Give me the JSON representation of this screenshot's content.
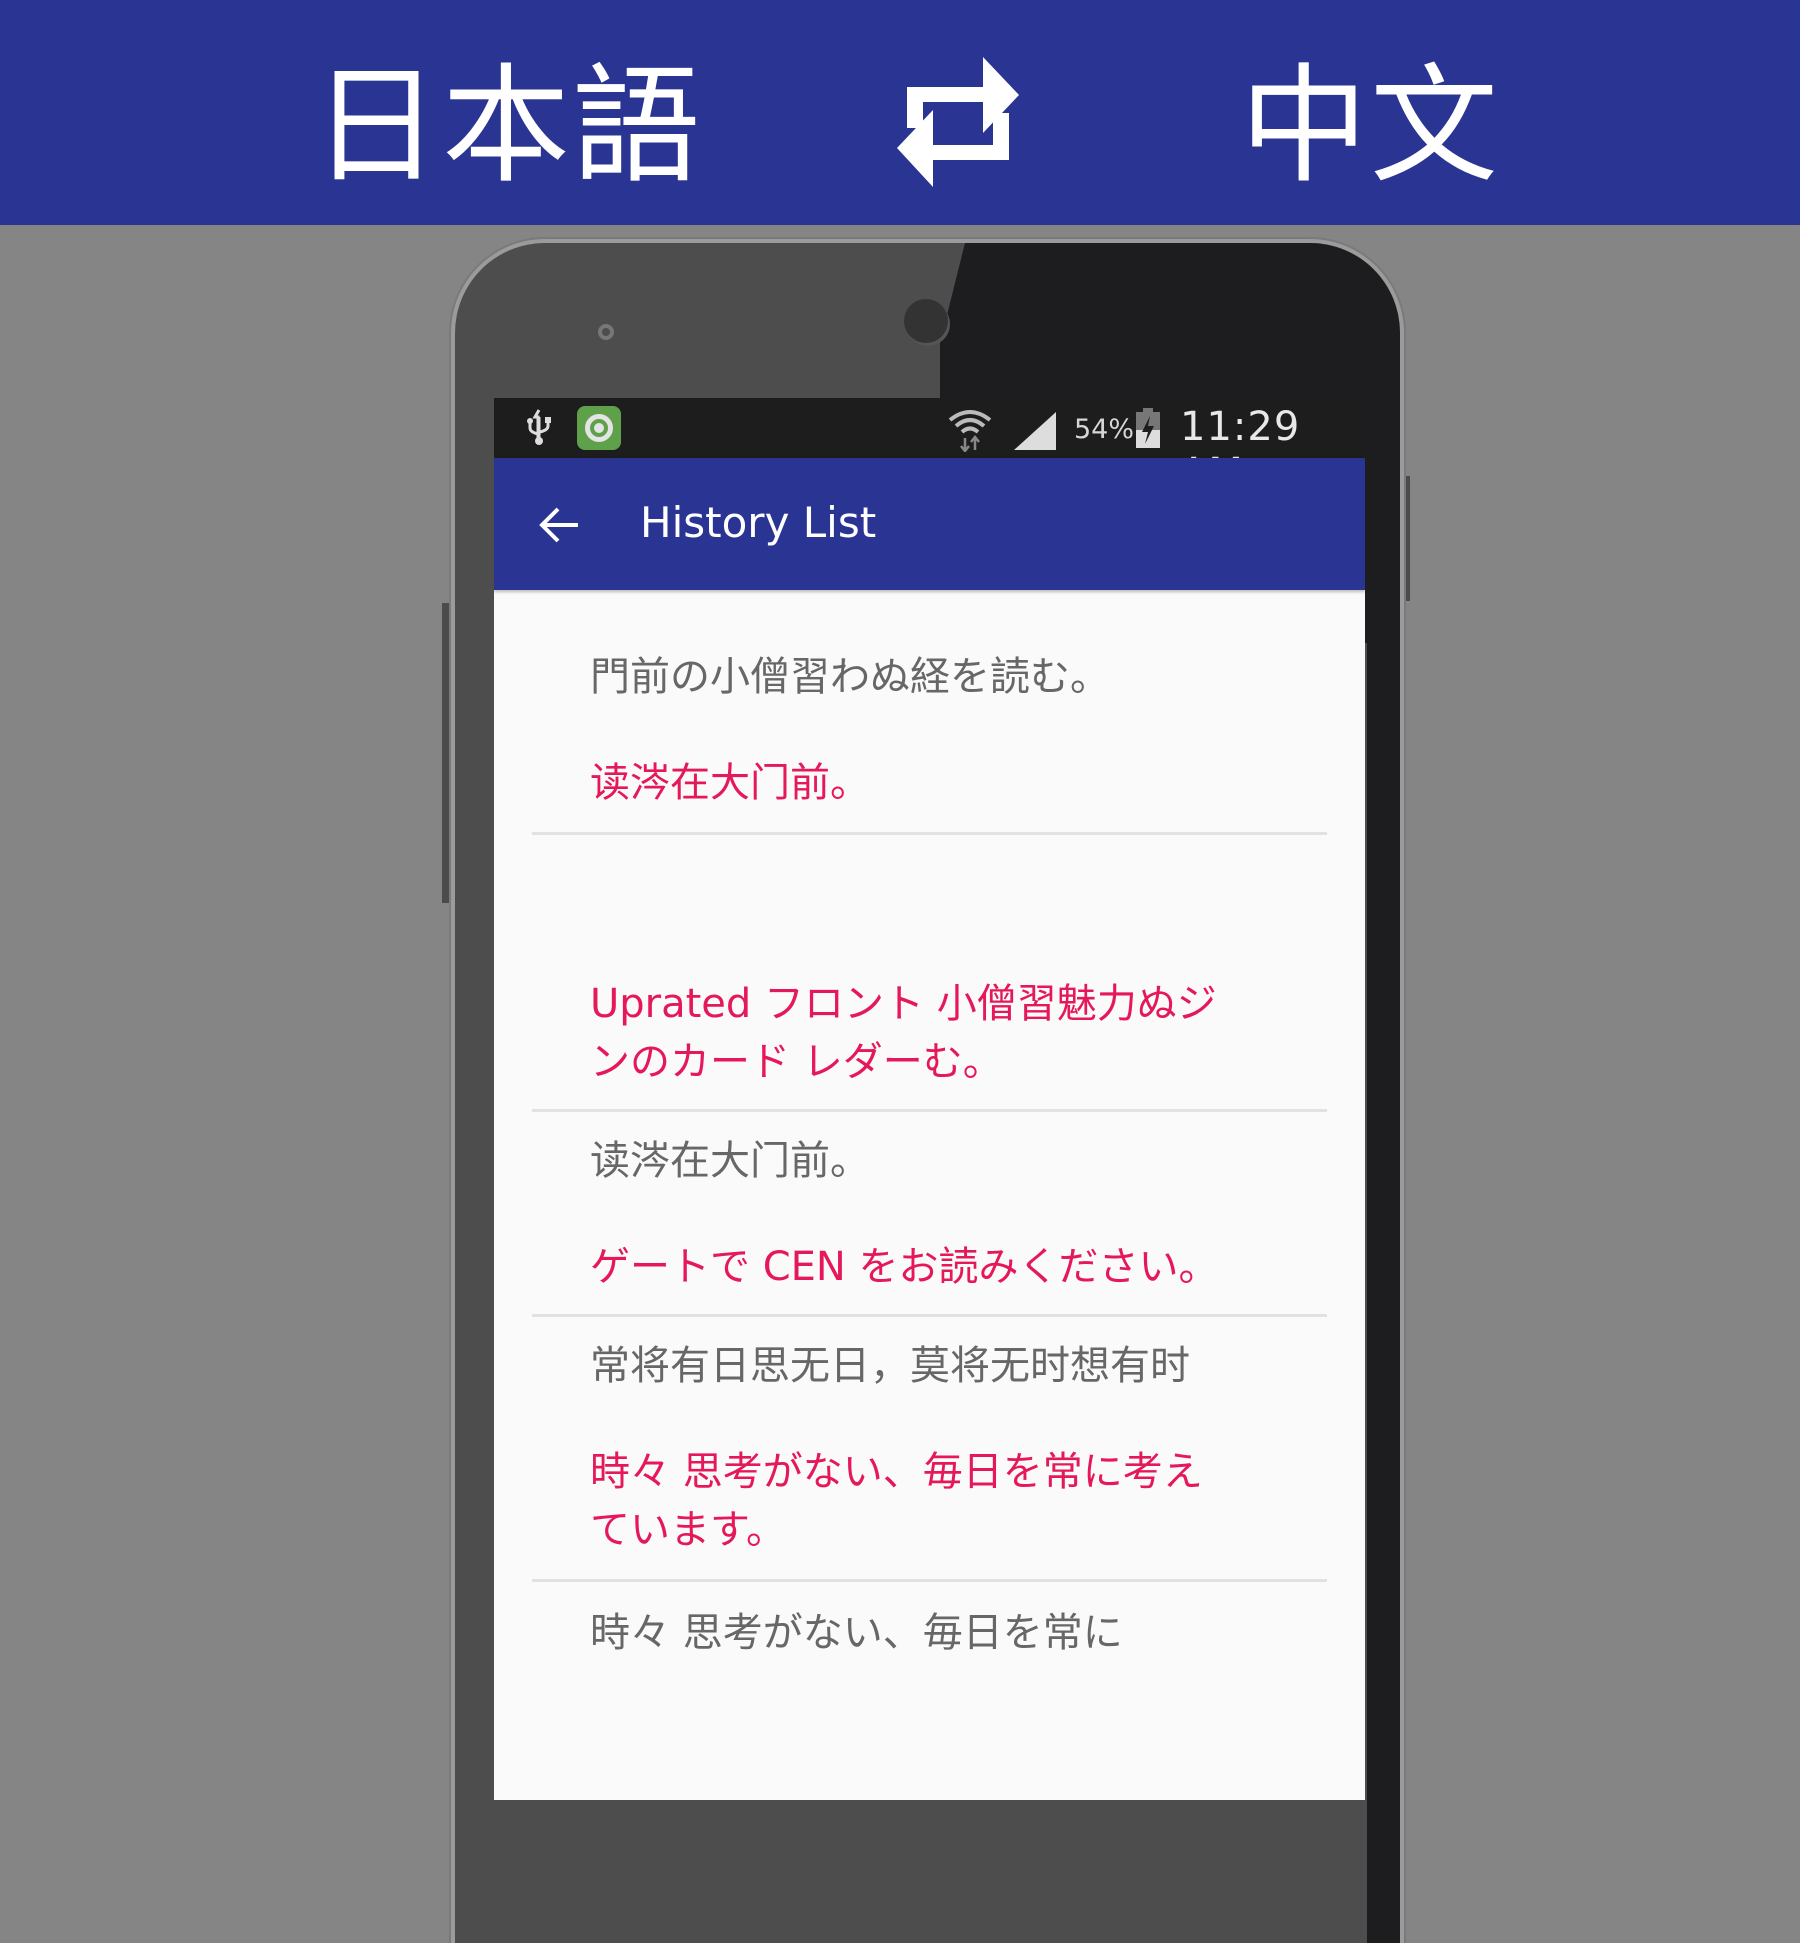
{
  "banner": {
    "source_language": "日本語",
    "target_language": "中文",
    "swap_icon": "swap-arrows-icon"
  },
  "statusbar": {
    "icons_left": [
      "usb-icon",
      "app-notification-icon"
    ],
    "icons_right": [
      "wifi-icon",
      "signal-icon",
      "battery-charging-icon"
    ],
    "battery_percent": "54%",
    "time": "11:29 AM"
  },
  "toolbar": {
    "back_icon": "arrow-back-icon",
    "title": "History List"
  },
  "history": [
    {
      "source": "門前の小僧習わぬ経を読む。",
      "translation": "读涔在大门前。"
    },
    {
      "source": "",
      "translation": "Uprated フロント 小僧習魅力ぬジンのカード レダーむ。"
    },
    {
      "source": "读涔在大门前。",
      "translation": "ゲートで CEN をお読みください。"
    },
    {
      "source": "常将有日思无日，莫将无时想有时",
      "translation": "時々 思考がない、毎日を常に考えています。"
    },
    {
      "source": "時々 思考がない、毎日を常に",
      "translation": ""
    }
  ],
  "colors": {
    "primary": "#2a3593",
    "translation_text": "#e5195a",
    "source_text": "#676767"
  }
}
